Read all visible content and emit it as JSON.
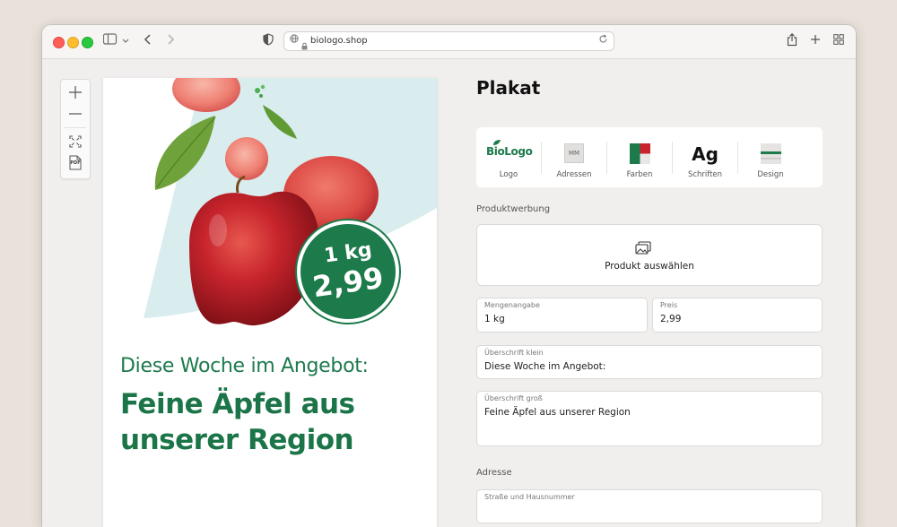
{
  "browser": {
    "url": "biologo.shop"
  },
  "zoom_toolbar": {
    "pdf_label": "PDF"
  },
  "poster": {
    "price_qty": "1 kg",
    "price_value": "2,99",
    "headline_small": "Diese Woche im Angebot:",
    "headline_big_line1": "Feine Äpfel aus",
    "headline_big_line2": "unserer Region"
  },
  "panel": {
    "title": "Plakat",
    "assets": [
      {
        "label": "Logo",
        "logo_text": "BioLogo"
      },
      {
        "label": "Adressen",
        "thumb_text": "MM"
      },
      {
        "label": "Farben"
      },
      {
        "label": "Schriften",
        "glyph": "Ag"
      },
      {
        "label": "Design"
      }
    ],
    "product_section_label": "Produktwerbung",
    "product_button_label": "Produkt auswählen",
    "fields": {
      "quantity": {
        "label": "Mengenangabe",
        "value": "1 kg"
      },
      "price": {
        "label": "Preis",
        "value": "2,99"
      },
      "headline_small": {
        "label": "Überschrift klein",
        "value": "Diese Woche im Angebot:"
      },
      "headline_big": {
        "label": "Überschrift groß",
        "value": "Feine Äpfel aus unserer Region"
      }
    },
    "address_section_label": "Adresse",
    "address_field": {
      "label": "Straße und Hausnummer"
    }
  },
  "colors": {
    "brand_green": "#1d7a4b",
    "accent_red": "#c7242c"
  }
}
